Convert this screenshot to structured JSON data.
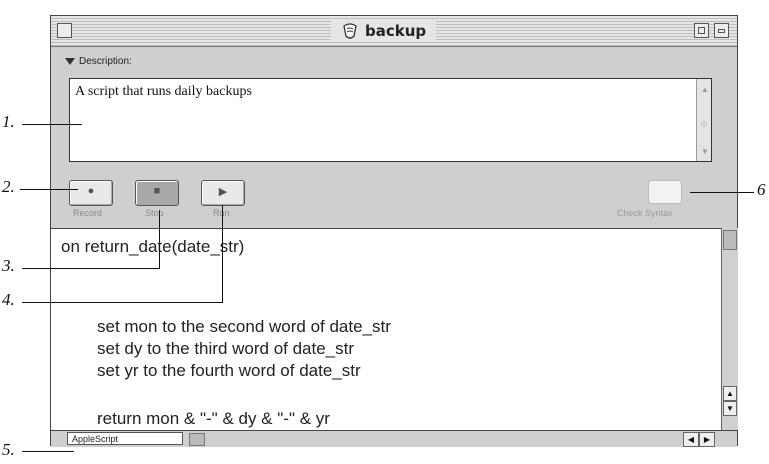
{
  "window": {
    "title": "backup",
    "description_header": "Description:",
    "description_text": "A script that runs daily backups"
  },
  "controls": {
    "record_label": "Record",
    "stop_label": "Stop",
    "run_label": "Run",
    "check_syntax_label": "Check Syntax"
  },
  "script": {
    "lines": [
      "on return_date(date_str)",
      "set mon to the second word of date_str",
      "set dy to the third word of date_str",
      "set yr to the fourth word of date_str",
      "return mon & \"-\" & dy & \"-\" & yr"
    ],
    "language": "AppleScript"
  },
  "callouts": [
    "1.",
    "2.",
    "3.",
    "4.",
    "5.",
    "6"
  ],
  "icons": [
    "script-icon",
    "close-box-icon",
    "zoom-box-icon",
    "collapse-box-icon",
    "disclosure-triangle-icon",
    "record-icon",
    "stop-icon",
    "run-icon",
    "scroll-up-arrow-icon",
    "scroll-down-arrow-icon",
    "scroll-left-arrow-icon",
    "scroll-right-arrow-icon"
  ]
}
